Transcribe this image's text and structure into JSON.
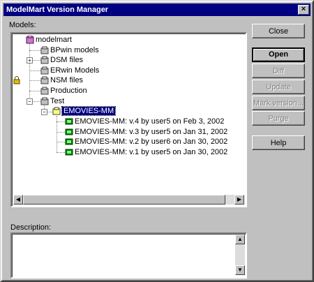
{
  "window": {
    "title": "ModelMart Version Manager"
  },
  "labels": {
    "models": "Models:",
    "models_accel": "M",
    "description": "Description:"
  },
  "tree": {
    "root": "modelmart",
    "items": [
      {
        "label": "BPwin models"
      },
      {
        "label": "DSM files"
      },
      {
        "label": "ERwin Models"
      },
      {
        "label": "NSM files"
      },
      {
        "label": "Production"
      },
      {
        "label": "Test"
      }
    ],
    "selected_model": "EMOVIES-MM",
    "versions": [
      {
        "label": "EMOVIES-MM: v.4 by  user5  on Feb 3,   2002"
      },
      {
        "label": "EMOVIES-MM: v.3 by  user5  on Jan 31, 2002"
      },
      {
        "label": "EMOVIES-MM: v.2 by  user6  on Jan 30, 2002"
      },
      {
        "label": "EMOVIES-MM: v.1 by  user5  on Jan 30, 2002"
      }
    ]
  },
  "buttons": {
    "close": "Close",
    "open": "Open",
    "diff": "Diff",
    "update": "Update",
    "mark_version": "Mark version...",
    "purge": "Purge",
    "help": "Help"
  },
  "colors": {
    "selection": "#000080",
    "title_bar": "#000080",
    "face": "#c0c0c0"
  },
  "icons": [
    "folder-icon",
    "model-icon",
    "version-icon",
    "lock-icon",
    "database-icon"
  ]
}
